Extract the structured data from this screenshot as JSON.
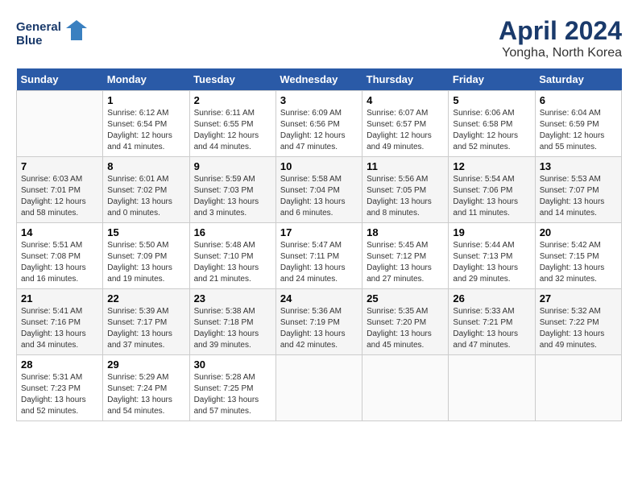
{
  "header": {
    "logo_line1": "General",
    "logo_line2": "Blue",
    "month": "April 2024",
    "location": "Yongha, North Korea"
  },
  "days_of_week": [
    "Sunday",
    "Monday",
    "Tuesday",
    "Wednesday",
    "Thursday",
    "Friday",
    "Saturday"
  ],
  "weeks": [
    [
      {
        "num": "",
        "sunrise": "",
        "sunset": "",
        "daylight": ""
      },
      {
        "num": "1",
        "sunrise": "Sunrise: 6:12 AM",
        "sunset": "Sunset: 6:54 PM",
        "daylight": "Daylight: 12 hours and 41 minutes."
      },
      {
        "num": "2",
        "sunrise": "Sunrise: 6:11 AM",
        "sunset": "Sunset: 6:55 PM",
        "daylight": "Daylight: 12 hours and 44 minutes."
      },
      {
        "num": "3",
        "sunrise": "Sunrise: 6:09 AM",
        "sunset": "Sunset: 6:56 PM",
        "daylight": "Daylight: 12 hours and 47 minutes."
      },
      {
        "num": "4",
        "sunrise": "Sunrise: 6:07 AM",
        "sunset": "Sunset: 6:57 PM",
        "daylight": "Daylight: 12 hours and 49 minutes."
      },
      {
        "num": "5",
        "sunrise": "Sunrise: 6:06 AM",
        "sunset": "Sunset: 6:58 PM",
        "daylight": "Daylight: 12 hours and 52 minutes."
      },
      {
        "num": "6",
        "sunrise": "Sunrise: 6:04 AM",
        "sunset": "Sunset: 6:59 PM",
        "daylight": "Daylight: 12 hours and 55 minutes."
      }
    ],
    [
      {
        "num": "7",
        "sunrise": "Sunrise: 6:03 AM",
        "sunset": "Sunset: 7:01 PM",
        "daylight": "Daylight: 12 hours and 58 minutes."
      },
      {
        "num": "8",
        "sunrise": "Sunrise: 6:01 AM",
        "sunset": "Sunset: 7:02 PM",
        "daylight": "Daylight: 13 hours and 0 minutes."
      },
      {
        "num": "9",
        "sunrise": "Sunrise: 5:59 AM",
        "sunset": "Sunset: 7:03 PM",
        "daylight": "Daylight: 13 hours and 3 minutes."
      },
      {
        "num": "10",
        "sunrise": "Sunrise: 5:58 AM",
        "sunset": "Sunset: 7:04 PM",
        "daylight": "Daylight: 13 hours and 6 minutes."
      },
      {
        "num": "11",
        "sunrise": "Sunrise: 5:56 AM",
        "sunset": "Sunset: 7:05 PM",
        "daylight": "Daylight: 13 hours and 8 minutes."
      },
      {
        "num": "12",
        "sunrise": "Sunrise: 5:54 AM",
        "sunset": "Sunset: 7:06 PM",
        "daylight": "Daylight: 13 hours and 11 minutes."
      },
      {
        "num": "13",
        "sunrise": "Sunrise: 5:53 AM",
        "sunset": "Sunset: 7:07 PM",
        "daylight": "Daylight: 13 hours and 14 minutes."
      }
    ],
    [
      {
        "num": "14",
        "sunrise": "Sunrise: 5:51 AM",
        "sunset": "Sunset: 7:08 PM",
        "daylight": "Daylight: 13 hours and 16 minutes."
      },
      {
        "num": "15",
        "sunrise": "Sunrise: 5:50 AM",
        "sunset": "Sunset: 7:09 PM",
        "daylight": "Daylight: 13 hours and 19 minutes."
      },
      {
        "num": "16",
        "sunrise": "Sunrise: 5:48 AM",
        "sunset": "Sunset: 7:10 PM",
        "daylight": "Daylight: 13 hours and 21 minutes."
      },
      {
        "num": "17",
        "sunrise": "Sunrise: 5:47 AM",
        "sunset": "Sunset: 7:11 PM",
        "daylight": "Daylight: 13 hours and 24 minutes."
      },
      {
        "num": "18",
        "sunrise": "Sunrise: 5:45 AM",
        "sunset": "Sunset: 7:12 PM",
        "daylight": "Daylight: 13 hours and 27 minutes."
      },
      {
        "num": "19",
        "sunrise": "Sunrise: 5:44 AM",
        "sunset": "Sunset: 7:13 PM",
        "daylight": "Daylight: 13 hours and 29 minutes."
      },
      {
        "num": "20",
        "sunrise": "Sunrise: 5:42 AM",
        "sunset": "Sunset: 7:15 PM",
        "daylight": "Daylight: 13 hours and 32 minutes."
      }
    ],
    [
      {
        "num": "21",
        "sunrise": "Sunrise: 5:41 AM",
        "sunset": "Sunset: 7:16 PM",
        "daylight": "Daylight: 13 hours and 34 minutes."
      },
      {
        "num": "22",
        "sunrise": "Sunrise: 5:39 AM",
        "sunset": "Sunset: 7:17 PM",
        "daylight": "Daylight: 13 hours and 37 minutes."
      },
      {
        "num": "23",
        "sunrise": "Sunrise: 5:38 AM",
        "sunset": "Sunset: 7:18 PM",
        "daylight": "Daylight: 13 hours and 39 minutes."
      },
      {
        "num": "24",
        "sunrise": "Sunrise: 5:36 AM",
        "sunset": "Sunset: 7:19 PM",
        "daylight": "Daylight: 13 hours and 42 minutes."
      },
      {
        "num": "25",
        "sunrise": "Sunrise: 5:35 AM",
        "sunset": "Sunset: 7:20 PM",
        "daylight": "Daylight: 13 hours and 45 minutes."
      },
      {
        "num": "26",
        "sunrise": "Sunrise: 5:33 AM",
        "sunset": "Sunset: 7:21 PM",
        "daylight": "Daylight: 13 hours and 47 minutes."
      },
      {
        "num": "27",
        "sunrise": "Sunrise: 5:32 AM",
        "sunset": "Sunset: 7:22 PM",
        "daylight": "Daylight: 13 hours and 49 minutes."
      }
    ],
    [
      {
        "num": "28",
        "sunrise": "Sunrise: 5:31 AM",
        "sunset": "Sunset: 7:23 PM",
        "daylight": "Daylight: 13 hours and 52 minutes."
      },
      {
        "num": "29",
        "sunrise": "Sunrise: 5:29 AM",
        "sunset": "Sunset: 7:24 PM",
        "daylight": "Daylight: 13 hours and 54 minutes."
      },
      {
        "num": "30",
        "sunrise": "Sunrise: 5:28 AM",
        "sunset": "Sunset: 7:25 PM",
        "daylight": "Daylight: 13 hours and 57 minutes."
      },
      {
        "num": "",
        "sunrise": "",
        "sunset": "",
        "daylight": ""
      },
      {
        "num": "",
        "sunrise": "",
        "sunset": "",
        "daylight": ""
      },
      {
        "num": "",
        "sunrise": "",
        "sunset": "",
        "daylight": ""
      },
      {
        "num": "",
        "sunrise": "",
        "sunset": "",
        "daylight": ""
      }
    ]
  ]
}
